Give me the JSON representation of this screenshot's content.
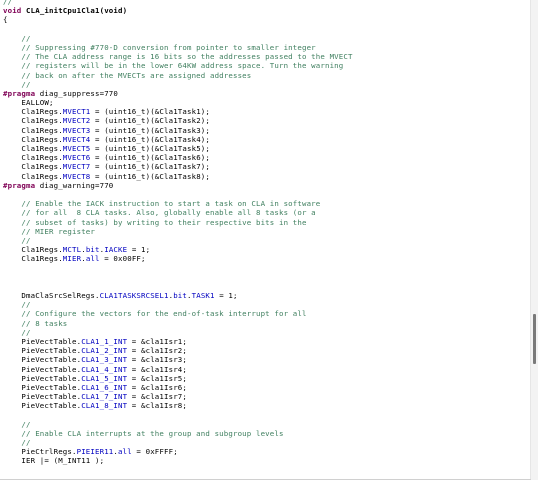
{
  "editor": {
    "lines": [
      [
        {
          "t": "//",
          "c": "c"
        }
      ],
      [
        {
          "t": "void",
          "c": "k"
        },
        {
          "t": " "
        },
        {
          "t": "CLA_initCpu1Cla1",
          "c": "b"
        },
        {
          "t": "(void)",
          "c": "b"
        }
      ],
      [
        {
          "t": "{"
        }
      ],
      [
        {
          "t": ""
        }
      ],
      [
        {
          "t": "    //",
          "c": "c"
        }
      ],
      [
        {
          "t": "    // Suppressing #770-D conversion from pointer to smaller integer",
          "c": "c"
        }
      ],
      [
        {
          "t": "    // The CLA address range is 16 bits so the addresses passed to the MVECT",
          "c": "c"
        }
      ],
      [
        {
          "t": "    // registers will be in the lower 64KW address space. Turn the warning",
          "c": "c"
        }
      ],
      [
        {
          "t": "    // back on after the MVECTs are assigned addresses",
          "c": "c"
        }
      ],
      [
        {
          "t": "    //",
          "c": "c"
        }
      ],
      [
        {
          "t": "#pragma",
          "c": "k"
        },
        {
          "t": " diag_suppress=770"
        }
      ],
      [
        {
          "t": "    EALLOW;"
        }
      ],
      [
        {
          "t": "    Cla1Regs."
        },
        {
          "t": "MVECT1",
          "c": "f"
        },
        {
          "t": " = (uint16_t)(&Cla1Task1);"
        }
      ],
      [
        {
          "t": "    Cla1Regs."
        },
        {
          "t": "MVECT2",
          "c": "f"
        },
        {
          "t": " = (uint16_t)(&Cla1Task2);"
        }
      ],
      [
        {
          "t": "    Cla1Regs."
        },
        {
          "t": "MVECT3",
          "c": "f"
        },
        {
          "t": " = (uint16_t)(&Cla1Task3);"
        }
      ],
      [
        {
          "t": "    Cla1Regs."
        },
        {
          "t": "MVECT4",
          "c": "f"
        },
        {
          "t": " = (uint16_t)(&Cla1Task4);"
        }
      ],
      [
        {
          "t": "    Cla1Regs."
        },
        {
          "t": "MVECT5",
          "c": "f"
        },
        {
          "t": " = (uint16_t)(&Cla1Task5);"
        }
      ],
      [
        {
          "t": "    Cla1Regs."
        },
        {
          "t": "MVECT6",
          "c": "f"
        },
        {
          "t": " = (uint16_t)(&Cla1Task6);"
        }
      ],
      [
        {
          "t": "    Cla1Regs."
        },
        {
          "t": "MVECT7",
          "c": "f"
        },
        {
          "t": " = (uint16_t)(&Cla1Task7);"
        }
      ],
      [
        {
          "t": "    Cla1Regs."
        },
        {
          "t": "MVECT8",
          "c": "f"
        },
        {
          "t": " = (uint16_t)(&Cla1Task8);"
        }
      ],
      [
        {
          "t": "#pragma",
          "c": "k"
        },
        {
          "t": " diag_warning=770"
        }
      ],
      [
        {
          "t": ""
        }
      ],
      [
        {
          "t": "    // Enable the IACK instruction to start a task on CLA in software",
          "c": "c"
        }
      ],
      [
        {
          "t": "    // for all  8 CLA tasks. Also, globally enable all 8 tasks (or a",
          "c": "c"
        }
      ],
      [
        {
          "t": "    // subset of tasks) by writing to their respective bits in the",
          "c": "c"
        }
      ],
      [
        {
          "t": "    // MIER register",
          "c": "c"
        }
      ],
      [
        {
          "t": "    //",
          "c": "c"
        }
      ],
      [
        {
          "t": "    Cla1Regs."
        },
        {
          "t": "MCTL",
          "c": "f"
        },
        {
          "t": "."
        },
        {
          "t": "bit",
          "c": "f"
        },
        {
          "t": "."
        },
        {
          "t": "IACKE",
          "c": "f"
        },
        {
          "t": " = 1;"
        }
      ],
      [
        {
          "t": "    Cla1Regs."
        },
        {
          "t": "MIER",
          "c": "f"
        },
        {
          "t": "."
        },
        {
          "t": "all",
          "c": "f"
        },
        {
          "t": " = 0x00FF;"
        }
      ],
      [
        {
          "t": ""
        }
      ],
      [
        {
          "t": ""
        }
      ],
      [
        {
          "t": ""
        }
      ],
      [
        {
          "t": "    DmaClaSrcSelRegs."
        },
        {
          "t": "CLA1TASKSRCSEL1",
          "c": "f"
        },
        {
          "t": "."
        },
        {
          "t": "bit",
          "c": "f"
        },
        {
          "t": "."
        },
        {
          "t": "TASK1",
          "c": "f"
        },
        {
          "t": " = 1;"
        }
      ],
      [
        {
          "t": "    //",
          "c": "c"
        }
      ],
      [
        {
          "t": "    // Configure the vectors for the end-of-task interrupt for all",
          "c": "c"
        }
      ],
      [
        {
          "t": "    // 8 tasks",
          "c": "c"
        }
      ],
      [
        {
          "t": "    //",
          "c": "c"
        }
      ],
      [
        {
          "t": "    PieVectTable."
        },
        {
          "t": "CLA1_1_INT",
          "c": "f"
        },
        {
          "t": " = &cla1Isr1;"
        }
      ],
      [
        {
          "t": "    PieVectTable."
        },
        {
          "t": "CLA1_2_INT",
          "c": "f"
        },
        {
          "t": " = &cla1Isr2;"
        }
      ],
      [
        {
          "t": "    PieVectTable."
        },
        {
          "t": "CLA1_3_INT",
          "c": "f"
        },
        {
          "t": " = &cla1Isr3;"
        }
      ],
      [
        {
          "t": "    PieVectTable."
        },
        {
          "t": "CLA1_4_INT",
          "c": "f"
        },
        {
          "t": " = &cla1Isr4;"
        }
      ],
      [
        {
          "t": "    PieVectTable."
        },
        {
          "t": "CLA1_5_INT",
          "c": "f"
        },
        {
          "t": " = &cla1Isr5;"
        }
      ],
      [
        {
          "t": "    PieVectTable."
        },
        {
          "t": "CLA1_6_INT",
          "c": "f"
        },
        {
          "t": " = &cla1Isr6;"
        }
      ],
      [
        {
          "t": "    PieVectTable."
        },
        {
          "t": "CLA1_7_INT",
          "c": "f"
        },
        {
          "t": " = &cla1Isr7;"
        }
      ],
      [
        {
          "t": "    PieVectTable."
        },
        {
          "t": "CLA1_8_INT",
          "c": "f"
        },
        {
          "t": " = &cla1Isr8;"
        }
      ],
      [
        {
          "t": ""
        }
      ],
      [
        {
          "t": "    //",
          "c": "c"
        }
      ],
      [
        {
          "t": "    // Enable CLA interrupts at the group and subgroup levels",
          "c": "c"
        }
      ],
      [
        {
          "t": "    //",
          "c": "c"
        }
      ],
      [
        {
          "t": "    PieCtrlRegs."
        },
        {
          "t": "PIEIER11",
          "c": "f"
        },
        {
          "t": "."
        },
        {
          "t": "all",
          "c": "f"
        },
        {
          "t": " = 0xFFFF;"
        }
      ],
      [
        {
          "t": "    IER |= (M_INT11 );"
        }
      ],
      [
        {
          "t": ""
        }
      ],
      [
        {
          "t": ""
        }
      ],
      [
        {
          "t": "}"
        }
      ]
    ]
  },
  "scrollbar": {
    "position": 0.73
  }
}
